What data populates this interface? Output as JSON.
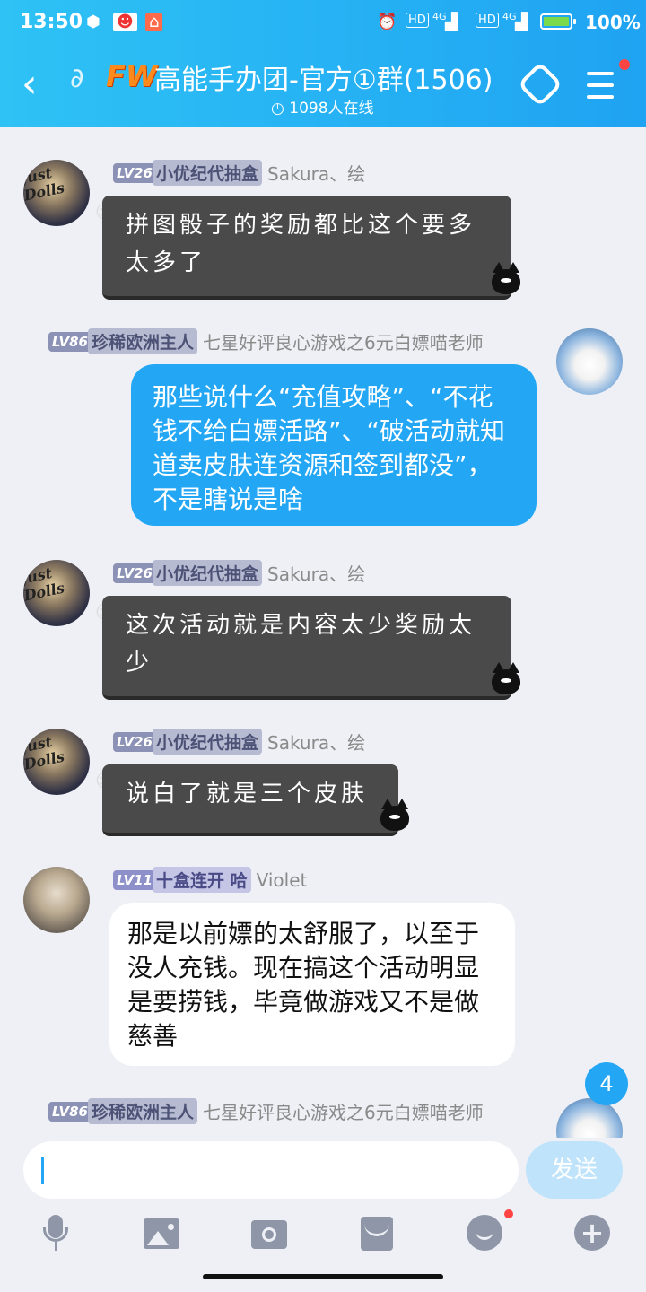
{
  "status_bar": {
    "time": "13:50",
    "battery": "100%",
    "net1": "4G",
    "net2": "4G",
    "hd1": "HD",
    "hd2": "HD"
  },
  "header": {
    "logo": "FW",
    "title": "高能手办团-官方①群(1506)",
    "online": "1098人在线",
    "accent": "#1fa3f2"
  },
  "messages": [
    {
      "level": "LV26",
      "tag": "小优纪代抽盒",
      "sender": "Sakura、绘",
      "text": "拼图骰子的奖励都比这个要多太多了",
      "avatar_label": "Just Dolls"
    },
    {
      "level": "LV86",
      "tag": "珍稀欧洲主人",
      "sender": "七星好评良心游戏之6元白嫖喵老师",
      "text": "那些说什么“充值攻略”、“不花钱不给白嫖活路”、“破活动就知道卖皮肤连资源和签到都没”，不是瞎说是啥"
    },
    {
      "level": "LV26",
      "tag": "小优纪代抽盒",
      "sender": "Sakura、绘",
      "text": "这次活动就是内容太少奖励太少",
      "avatar_label": "Just Dolls"
    },
    {
      "level": "LV26",
      "tag": "小优纪代抽盒",
      "sender": "Sakura、绘",
      "text": "说白了就是三个皮肤",
      "avatar_label": "Just Dolls"
    },
    {
      "level": "LV11",
      "tag": "十盒连开 哈",
      "sender": "Violet",
      "text": "那是以前嫖的太舒服了，以至于没人充钱。现在搞这个活动明显是要捞钱，毕竟做游戏又不是做慈善"
    },
    {
      "level": "LV86",
      "tag": "珍稀欧洲主人",
      "sender": "七星好评良心游戏之6元白嫖喵老师",
      "text": ""
    }
  ],
  "unread_count": "4",
  "input": {
    "value": "",
    "send_label": "发送"
  }
}
